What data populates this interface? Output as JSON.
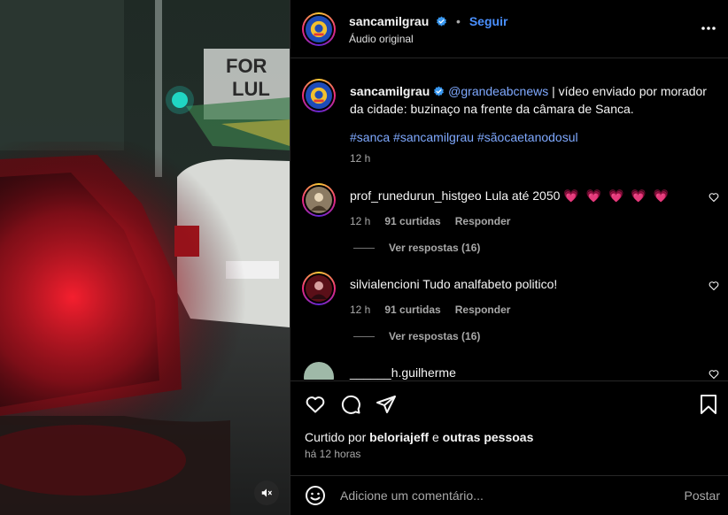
{
  "post": {
    "username": "sancamilgrau",
    "follow_label": "Seguir",
    "separator": "•",
    "audio": "Áudio original",
    "more_icon": "more-options-icon"
  },
  "caption": {
    "username": "sancamilgrau",
    "mention": "@grandeabcnews",
    "text": " | vídeo enviado por morador da cidade: buzinaço na frente da câmara de Sanca.",
    "hashtags": "#sanca #sancamilgrau #sãocaetanodosul",
    "time": "12 h"
  },
  "comments": [
    {
      "username": "prof_runedurun_histgeo",
      "text": "Lula até 2050",
      "hearts": "💗 💗 💗 💗 💗",
      "time": "12 h",
      "likes": "91 curtidas",
      "reply_label": "Responder",
      "view_replies": "Ver respostas (16)"
    },
    {
      "username": "silvialencioni",
      "text": "Tudo analfabeto politico!",
      "hearts": "",
      "time": "12 h",
      "likes": "91 curtidas",
      "reply_label": "Responder",
      "view_replies": "Ver respostas (16)"
    },
    {
      "username": "______h.guilherme",
      "text": "",
      "hearts": ""
    }
  ],
  "likes": {
    "prefix": "Curtido por",
    "user": "beloriajeff",
    "joiner": "e",
    "others": "outras pessoas"
  },
  "time_ago": "há 12 horas",
  "add_comment": {
    "placeholder": "Adicione um comentário...",
    "post_label": "Postar"
  },
  "colors": {
    "link_blue": "#4a90ff",
    "mention_blue": "#7fa9ff",
    "verified_blue": "#3897f0",
    "heart_pink": "#ff3b6b"
  }
}
